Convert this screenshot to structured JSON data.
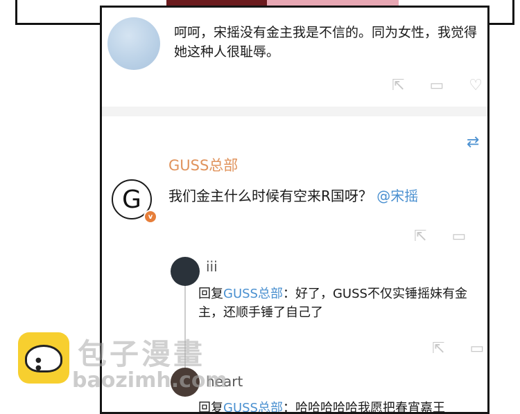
{
  "comment1": {
    "text": "呵呵，宋摇没有金主我是不信的。同为女性，我觉得她这种人很耻辱。"
  },
  "comment2": {
    "username": "GUSS总部",
    "avatar_letter": "G",
    "verified_badge": "v",
    "text": "我们金主什么时候有空来R国呀？",
    "mention": "@宋摇"
  },
  "replies": [
    {
      "username": "iii",
      "reply_prefix": "回复",
      "reply_to": "GUSS总部",
      "text": "：好了，GUSS不仅实锤摇妹有金主，还顺手锤了自己了"
    },
    {
      "username": "heart",
      "reply_prefix": "回复",
      "reply_to": "GUSS总部",
      "text": "：哈哈哈哈哈我愿把春宵嘉王"
    }
  ],
  "watermark": {
    "title": "包子漫畫",
    "url": "baozimh.com"
  },
  "colors": {
    "username": "#e0935c",
    "link": "#4a90d0",
    "badge": "#e67e3a"
  }
}
